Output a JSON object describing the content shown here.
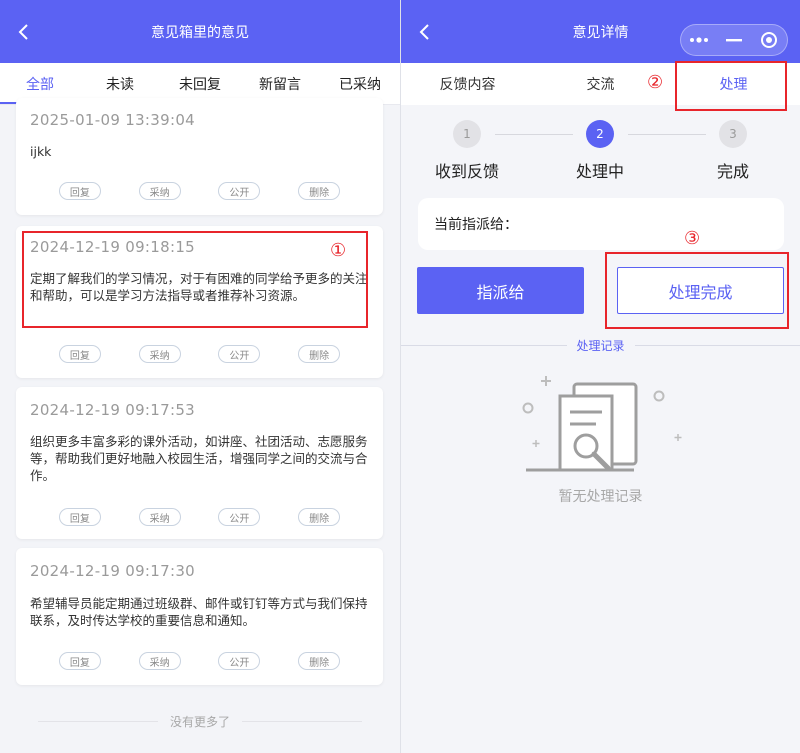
{
  "left": {
    "header": {
      "title": "意见箱里的意见"
    },
    "tabs": [
      {
        "label": "全部",
        "active": true
      },
      {
        "label": "未读",
        "active": false
      },
      {
        "label": "未回复",
        "active": false
      },
      {
        "label": "新留言",
        "active": false
      },
      {
        "label": "已采纳",
        "active": false
      }
    ],
    "actions": {
      "reply": "回复",
      "adopt": "采纳",
      "public": "公开",
      "delete": "删除"
    },
    "cards": [
      {
        "time": "2025-01-09 13:39:04",
        "text": "ijkk"
      },
      {
        "time": "2024-12-19 09:18:15",
        "text": "定期了解我们的学习情况，对于有困难的同学给予更多的关注和帮助，可以是学习方法指导或者推荐补习资源。"
      },
      {
        "time": "2024-12-19 09:17:53",
        "text": "组织更多丰富多彩的课外活动，如讲座、社团活动、志愿服务等，帮助我们更好地融入校园生活，增强同学之间的交流与合作。"
      },
      {
        "time": "2024-12-19 09:17:30",
        "text": "希望辅导员能定期通过班级群、邮件或钉钉等方式与我们保持联系，及时传达学校的重要信息和通知。"
      }
    ],
    "no_more": "没有更多了"
  },
  "right": {
    "header": {
      "title": "意见详情"
    },
    "tabs": [
      {
        "label": "反馈内容",
        "active": false
      },
      {
        "label": "交流",
        "active": false
      },
      {
        "label": "处理",
        "active": true
      }
    ],
    "steps": [
      {
        "num": "1",
        "label": "收到反馈",
        "state": "done"
      },
      {
        "num": "2",
        "label": "处理中",
        "state": "current"
      },
      {
        "num": "3",
        "label": "完成",
        "state": "todo"
      }
    ],
    "assign_label": "当前指派给：",
    "assign_button": "指派给",
    "done_button": "处理完成",
    "records_title": "处理记录",
    "empty_text": "暂无处理记录"
  },
  "annotations": {
    "marker1": "①",
    "marker2": "②",
    "marker3": "③"
  },
  "colors": {
    "primary": "#5b62f3",
    "annotation": "#e8252b"
  }
}
